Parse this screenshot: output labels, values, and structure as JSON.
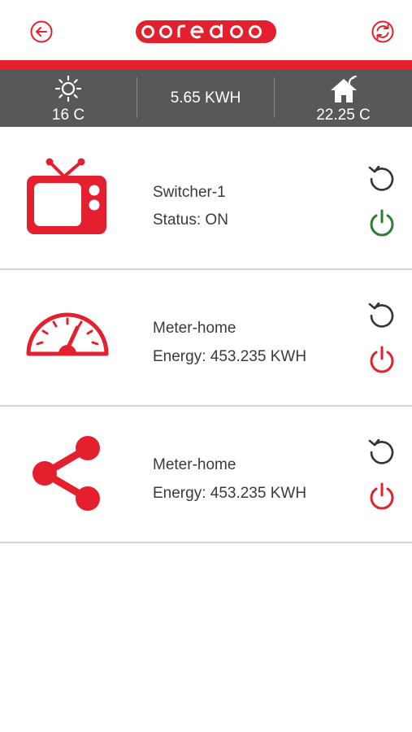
{
  "header": {
    "back_icon": "back-arrow-icon",
    "logo_text": "ooredoo",
    "refresh_icon": "refresh-icon",
    "brand_color": "#e4202e"
  },
  "stats": {
    "outdoor_temp": "16 C",
    "outdoor_icon": "sun-icon",
    "energy": "5.65 KWH",
    "indoor_temp": "22.25 C",
    "indoor_icon": "smart-home-icon",
    "bar_color": "#58585a"
  },
  "devices": [
    {
      "icon": "tv-icon",
      "name": "Switcher-1",
      "info": "Status: ON",
      "reset_icon": "reset-icon",
      "power_icon": "power-icon",
      "power_color": "#2e7d32"
    },
    {
      "icon": "gauge-meter-icon",
      "name": "Meter-home",
      "info": "Energy: 453.235 KWH",
      "reset_icon": "reset-icon",
      "power_icon": "power-icon",
      "power_color": "#e4202e"
    },
    {
      "icon": "share-icon",
      "name": "Meter-home",
      "info": "Energy: 453.235 KWH",
      "reset_icon": "reset-icon",
      "power_icon": "power-icon",
      "power_color": "#e4202e"
    }
  ]
}
